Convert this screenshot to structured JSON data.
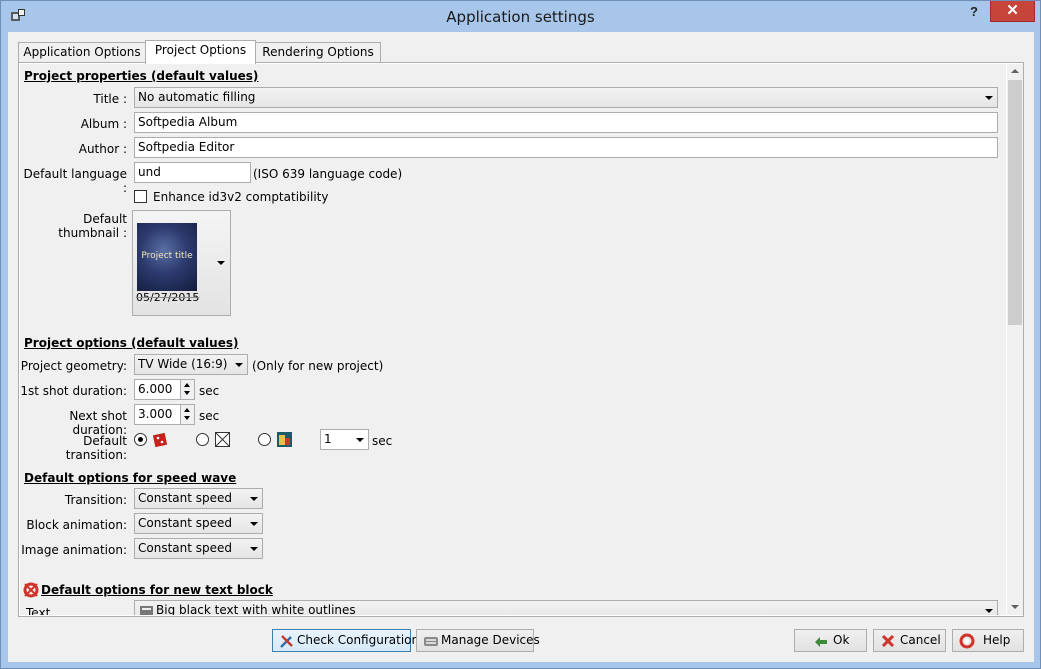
{
  "window": {
    "title": "Application settings",
    "help_glyph": "?",
    "close_glyph": "✕"
  },
  "tabs": [
    "Application Options",
    "Project Options",
    "Rendering Options"
  ],
  "properties": {
    "section": "Project properties (default values)",
    "title_label": "Title :",
    "title_value": "No automatic filling",
    "album_label": "Album :",
    "album_value": "Softpedia Album",
    "author_label": "Author :",
    "author_value": "Softpedia Editor",
    "language_label": "Default language :",
    "language_value": "und",
    "language_hint": "(ISO 639 language code)",
    "enhance_label": "Enhance id3v2 comptatibility",
    "thumbnail_label": "Default thumbnail :",
    "thumbnail_caption": "Project title",
    "thumbnail_date": "05/27/2015"
  },
  "options": {
    "section": "Project options (default values)",
    "geometry_label": "Project geometry:",
    "geometry_value": "TV Wide (16:9)",
    "geometry_hint": "(Only for new project)",
    "first_label": "1st shot duration:",
    "first_value": "6.000",
    "next_label": "Next shot duration:",
    "next_value": "3.000",
    "unit_sec": "sec",
    "transition_label": "Default transition:",
    "transition_duration": "1"
  },
  "speedwave": {
    "section": "Default options for speed wave",
    "transition_label": "Transition:",
    "transition_value": "Constant speed",
    "block_label": "Block animation:",
    "block_value": "Constant speed",
    "image_label": "Image animation:",
    "image_value": "Constant speed"
  },
  "textblock": {
    "section": "Default options for new text block",
    "text_label": "Text",
    "text_value": "Big black text with white outlines"
  },
  "buttons": {
    "check": "Check Configuration",
    "devices": "Manage Devices",
    "ok": "Ok",
    "cancel": "Cancel",
    "help": "Help"
  }
}
